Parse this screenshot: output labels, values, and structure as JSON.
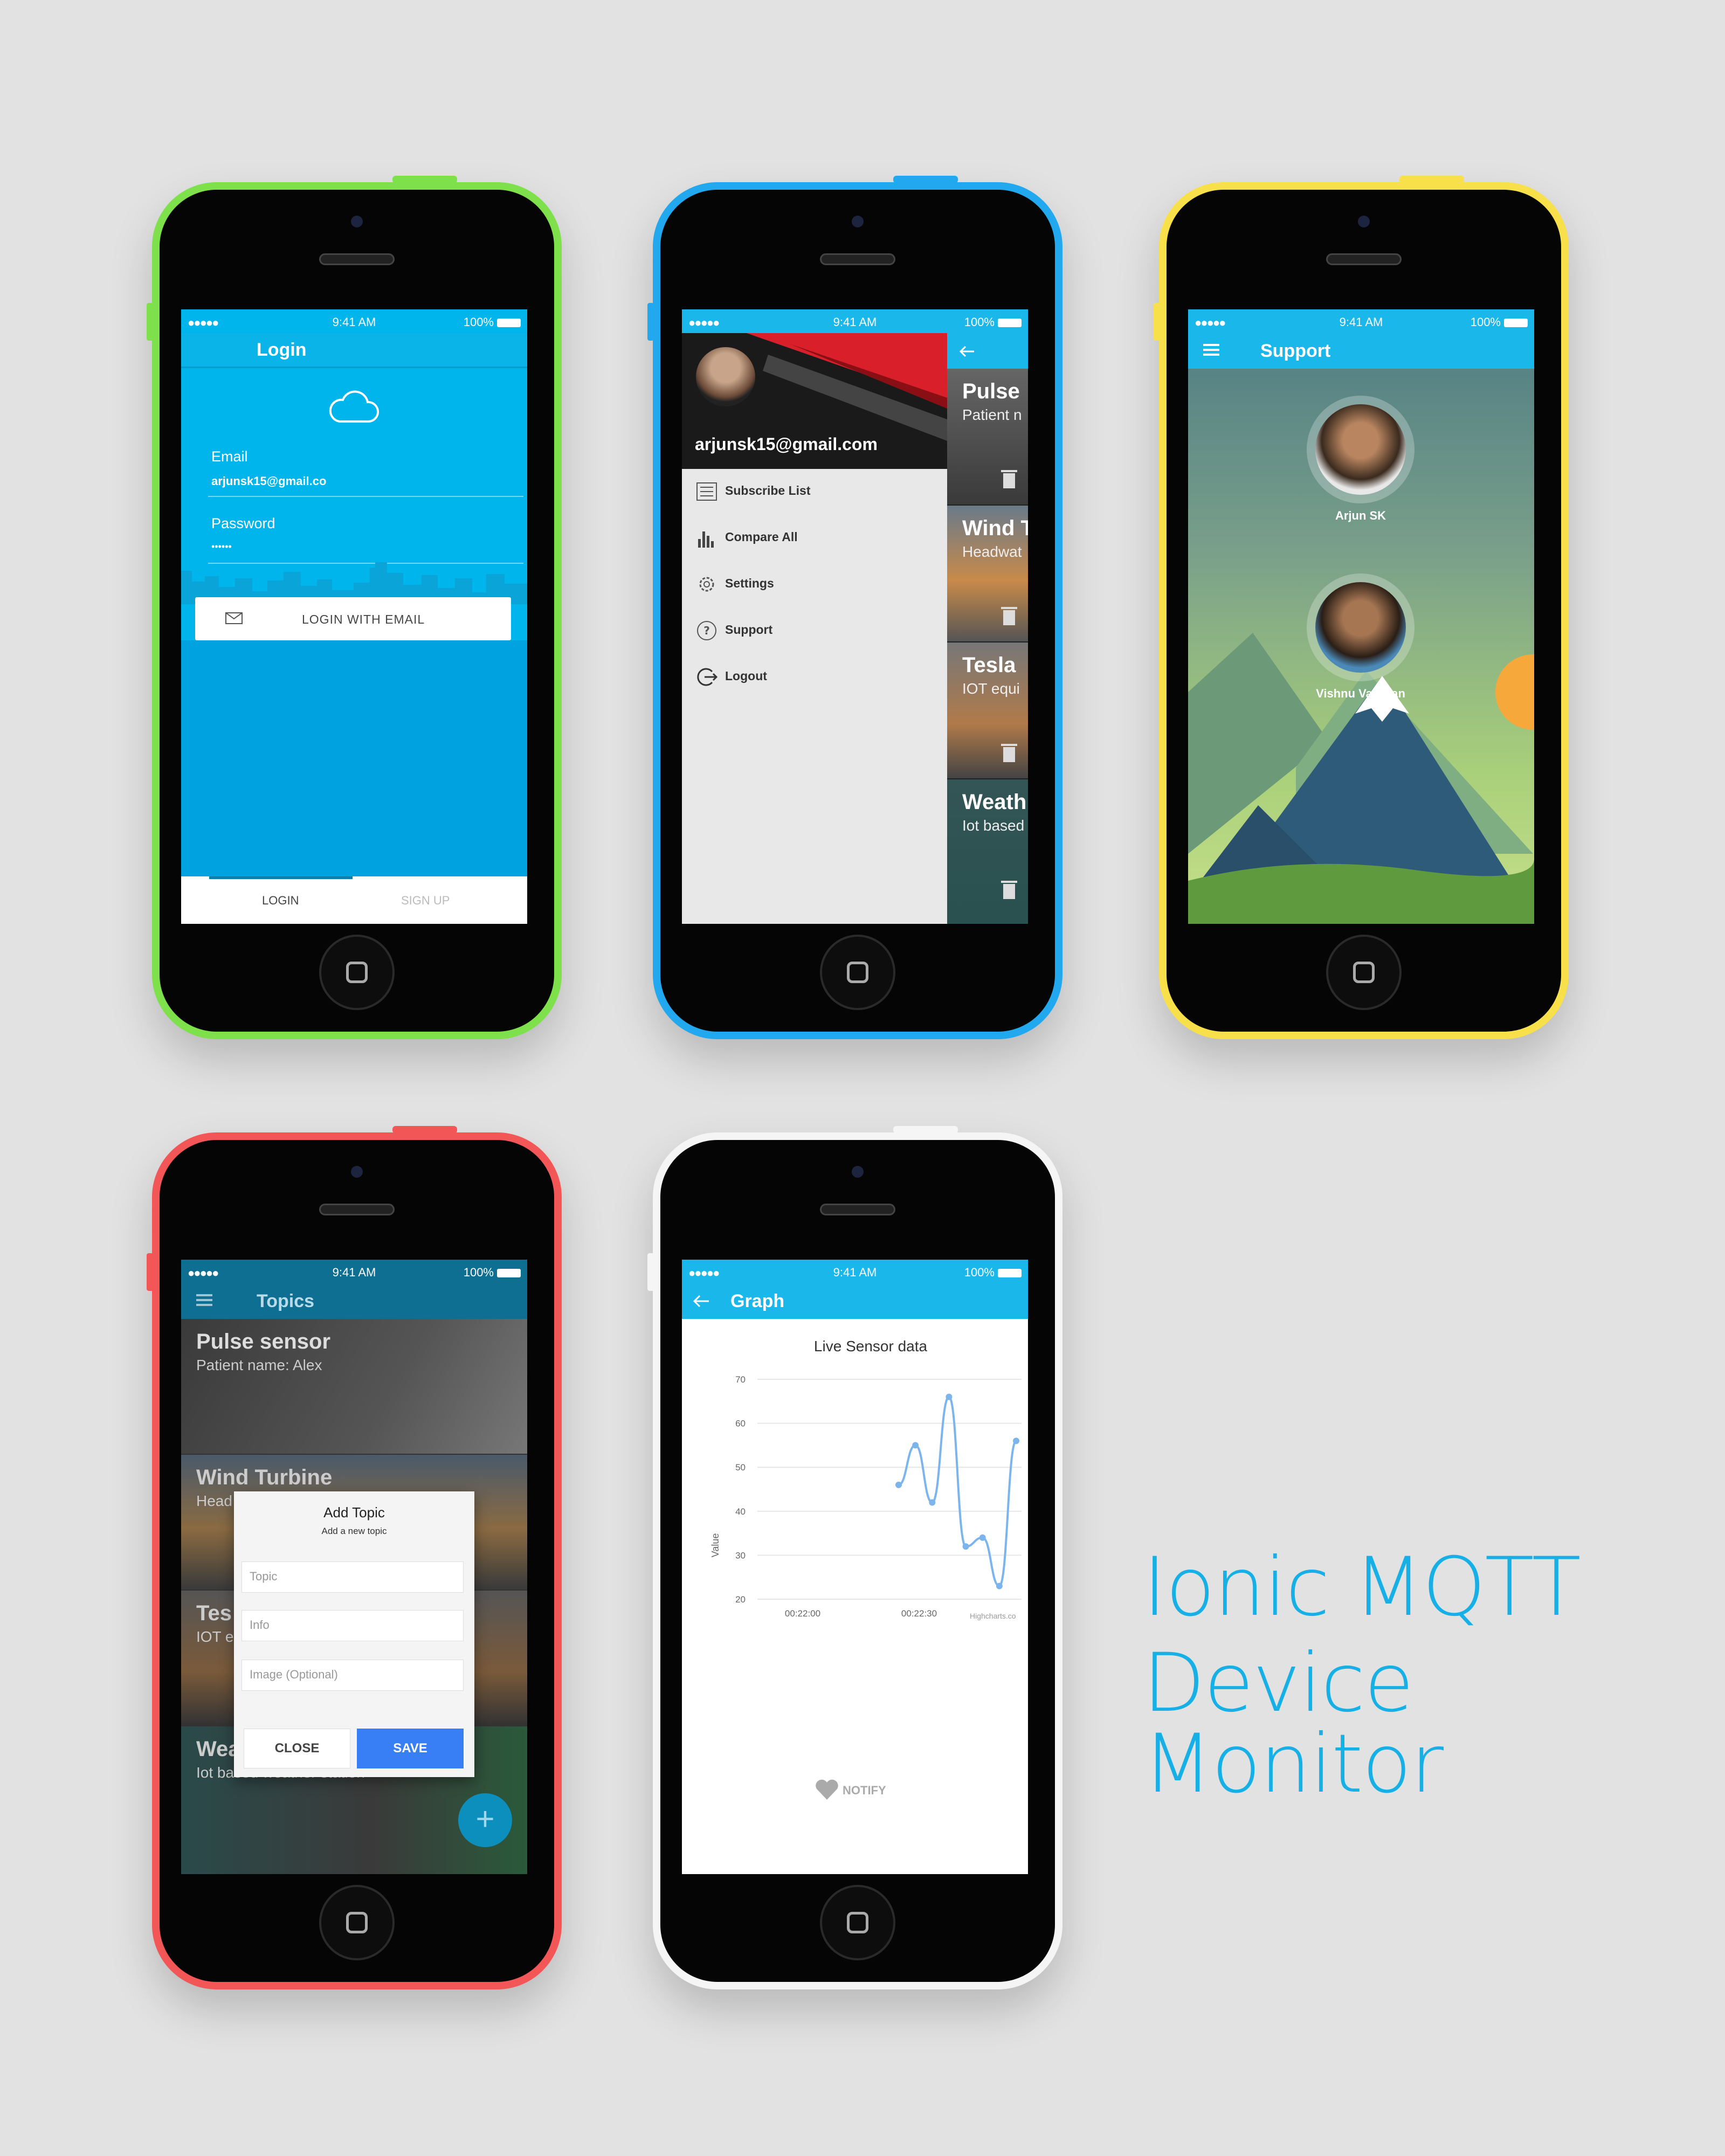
{
  "status": {
    "signal": "●●●●● ",
    "time": "9:41 AM",
    "battery": "100%"
  },
  "login": {
    "title": "Login",
    "email_label": "Email",
    "email_value": "arjunsk15@gmail.co",
    "password_label": "Password",
    "password_value": "••••••",
    "login_button": "LOGIN WITH EMAIL",
    "tabs": [
      "LOGIN",
      "SIGN UP"
    ]
  },
  "menu": {
    "email": "arjunsk15@gmail.com",
    "items": [
      "Subscribe List",
      "Compare All",
      "Settings",
      "Support",
      "Logout"
    ],
    "cards": [
      {
        "title": "Pulse",
        "sub": "Patient n"
      },
      {
        "title": "Wind T",
        "sub": "Headwat"
      },
      {
        "title": "Tesla",
        "sub": "IOT equi"
      },
      {
        "title": "Weath",
        "sub": "Iot based"
      }
    ]
  },
  "support": {
    "title": "Support",
    "people": [
      "Arjun SK",
      "Vishnu Vardhan"
    ]
  },
  "topics": {
    "title": "Topics",
    "cards": [
      {
        "title": "Pulse sensor",
        "sub": "Patient name: Alex"
      },
      {
        "title": "Wind Turbine",
        "sub": "Head"
      },
      {
        "title": "Tes",
        "sub": "IOT equipped"
      },
      {
        "title": "Weather Station",
        "sub": "Iot based weather station"
      }
    ],
    "dialog": {
      "title": "Add Topic",
      "subtitle": "Add a new topic",
      "topic_placeholder": "Topic",
      "info_placeholder": "Info",
      "image_placeholder": "Image (Optional)",
      "close": "CLOSE",
      "save": "SAVE"
    }
  },
  "graph": {
    "title": "Graph",
    "notify": "NOTIFY",
    "credit": "Highcharts.co"
  },
  "chart_data": {
    "type": "line",
    "title": "Live Sensor data",
    "ylabel": "Value",
    "xlabel": "",
    "ylim": [
      20,
      70
    ],
    "yticks": [
      20,
      30,
      40,
      50,
      60,
      70
    ],
    "xticks": [
      "00:22:00",
      "00:22:30"
    ],
    "series": [
      {
        "values": [
          46,
          55,
          42,
          66,
          32,
          34,
          23,
          56
        ]
      }
    ],
    "color": "#7cb5ec"
  },
  "headline": {
    "line1": "Ionic MQTT",
    "line2": "Device Monitor"
  },
  "colors": {
    "accent": "#1ab7ea",
    "green": "#7ee04a",
    "blue": "#22a8ee",
    "yellow": "#f8e04a",
    "red": "#f25656",
    "white": "#f5f5f5"
  }
}
